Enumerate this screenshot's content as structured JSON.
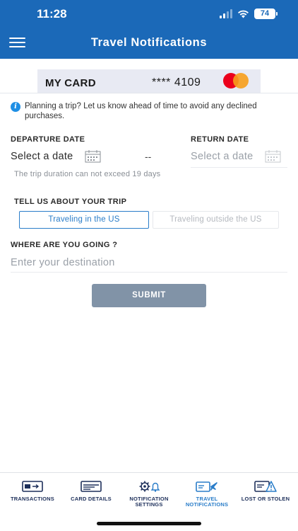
{
  "status_bar": {
    "time": "11:28",
    "battery": "74"
  },
  "header": {
    "title": "Travel Notifications"
  },
  "card": {
    "name": "MY CARD",
    "number_masked": "**** 4109"
  },
  "info": {
    "text": "Planning a trip? Let us know ahead of time to avoid any declined purchases."
  },
  "dates": {
    "departure_label": "DEPARTURE DATE",
    "departure_value": "Select a date",
    "separator": "--",
    "return_label": "RETURN DATE",
    "return_value": "Select a date",
    "hint": "The trip duration can not exceed 19 days"
  },
  "trip": {
    "label": "TELL US ABOUT YOUR TRIP",
    "options": [
      "Traveling in the US",
      "Traveling outside the US"
    ],
    "selected": "Traveling in the US"
  },
  "destination": {
    "label": "WHERE ARE YOU GOING ?",
    "placeholder": "Enter your destination",
    "value": ""
  },
  "submit_label": "SUBMIT",
  "bottom_nav": {
    "items": [
      {
        "label": "TRANSACTIONS",
        "icon": "transactions-icon",
        "active": false
      },
      {
        "label": "CARD DETAILS",
        "icon": "card-details-icon",
        "active": false
      },
      {
        "label": "NOTIFICATION SETTINGS",
        "icon": "notification-settings-icon",
        "active": false
      },
      {
        "label": "TRAVEL NOTIFICATIONS",
        "icon": "travel-notifications-icon",
        "active": true
      },
      {
        "label": "LOST OR STOLEN",
        "icon": "lost-or-stolen-icon",
        "active": false
      }
    ]
  },
  "colors": {
    "header": "#1b69b8",
    "accent": "#2a7dc9",
    "submit": "#8193a7",
    "nav_text": "#1d2f5a"
  }
}
